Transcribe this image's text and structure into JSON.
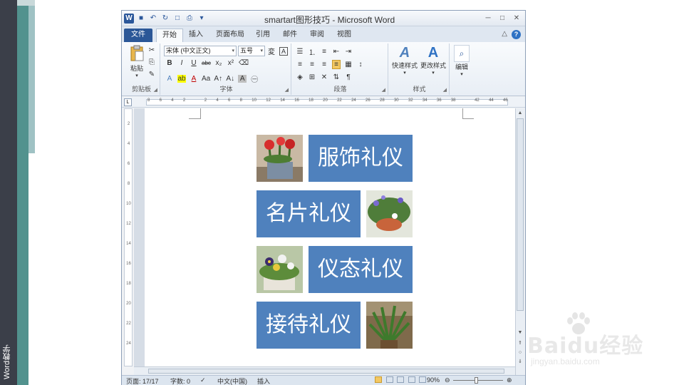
{
  "sidebar": {
    "label": "Word教学"
  },
  "watermark": {
    "text": "Baidu经验",
    "url": "jingyan.baidu.com"
  },
  "window": {
    "title": "smartart图形技巧 - Microsoft Word",
    "tabs": [
      {
        "label": "文件"
      },
      {
        "label": "开始"
      },
      {
        "label": "插入"
      },
      {
        "label": "页面布局"
      },
      {
        "label": "引用"
      },
      {
        "label": "邮件"
      },
      {
        "label": "审阅"
      },
      {
        "label": "视图"
      }
    ]
  },
  "ribbon": {
    "clipboard": {
      "paste_label": "粘贴",
      "group_label": "剪贴板"
    },
    "font": {
      "font_name": "宋体 (中文正文)",
      "font_size": "五号",
      "group_label": "字体"
    },
    "paragraph": {
      "group_label": "段落"
    },
    "styles": {
      "quick_styles_label": "快速样式",
      "change_styles_label": "更改样式",
      "group_label": "样式"
    },
    "editing": {
      "label": "编辑"
    }
  },
  "ruler": {
    "marks": [
      "8",
      "6",
      "4",
      "2",
      "",
      "2",
      "4",
      "6",
      "8",
      "10",
      "12",
      "14",
      "16",
      "18",
      "20",
      "22",
      "24",
      "26",
      "28",
      "30",
      "32",
      "34",
      "36",
      "38",
      "",
      "42",
      "44",
      "46"
    ]
  },
  "vruler": {
    "marks": [
      "2",
      "4",
      "6",
      "8",
      "10",
      "12",
      "14",
      "16",
      "18",
      "20",
      "22",
      "24"
    ]
  },
  "smartart": {
    "items": [
      {
        "label": "服饰礼仪"
      },
      {
        "label": "名片礼仪"
      },
      {
        "label": "仪态礼仪"
      },
      {
        "label": "接待礼仪"
      }
    ],
    "box_color": "#4f81bd"
  },
  "status": {
    "page": "页面: 17/17",
    "words": "字数: 0",
    "language": "中文(中国)",
    "mode": "插入",
    "zoom": "90%"
  }
}
